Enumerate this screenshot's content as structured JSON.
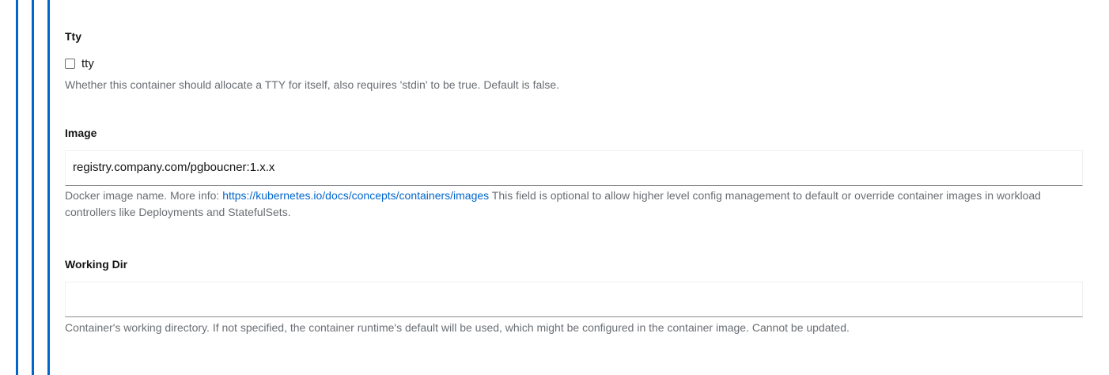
{
  "accent_color": "#0066cc",
  "tty": {
    "label": "Tty",
    "checkbox_label": "tty",
    "checked": false,
    "help": "Whether this container should allocate a TTY for itself, also requires 'stdin' to be true. Default is false."
  },
  "image": {
    "label": "Image",
    "value": "registry.company.com/pgboucner:1.x.x",
    "help_prefix": "Docker image name. More info: ",
    "help_link": "https://kubernetes.io/docs/concepts/containers/images",
    "help_suffix": " This field is optional to allow higher level config management to default or override container images in workload controllers like Deployments and StatefulSets."
  },
  "working_dir": {
    "label": "Working Dir",
    "value": "",
    "help": "Container's working directory. If not specified, the container runtime's default will be used, which might be configured in the container image. Cannot be updated."
  }
}
